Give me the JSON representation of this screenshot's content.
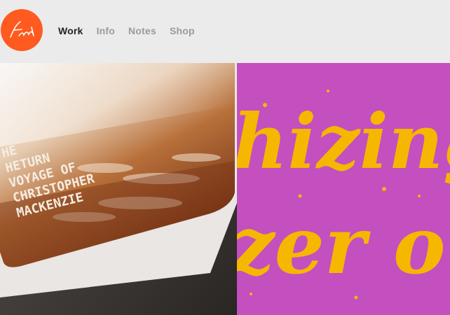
{
  "brand": {
    "logo_signature": "Frank",
    "accent_color": "#ff5a1f"
  },
  "nav": {
    "items": [
      {
        "label": "Work",
        "active": true
      },
      {
        "label": "Info",
        "active": false
      },
      {
        "label": "Notes",
        "active": false
      },
      {
        "label": "Shop",
        "active": false
      }
    ]
  },
  "projects": [
    {
      "cover_lines": [
        "HE",
        "HETURN",
        "VOYAGE OF",
        "CHRISTOPHER",
        "MACKENZIE"
      ]
    },
    {
      "lettering_lines": [
        "hizing",
        "zer o"
      ],
      "background": "#c44fbf",
      "ink": "#f5b700"
    }
  ]
}
